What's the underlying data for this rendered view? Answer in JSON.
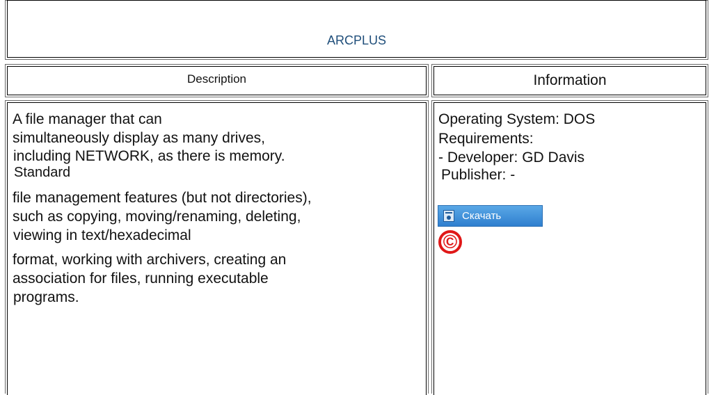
{
  "program": {
    "title": "ARCPLUS"
  },
  "headers": {
    "description": "Description",
    "information": "Information"
  },
  "description_lines": [
    "A file manager that can",
    "simultaneously display as many drives,",
    "including NETWORK, as there is memory.",
    "Standard",
    "file management features (but not directories),",
    "such as copying, moving/renaming, deleting,",
    "viewing in text/hexadecimal",
    "format, working with archivers, creating an",
    "association for files, running executable",
    "programs."
  ],
  "info": {
    "os": "Operating System: DOS",
    "requirements": "Requirements:",
    "developer": "- Developer: GD Davis",
    "publisher": "Publisher: -",
    "download_label": "Скачать",
    "copyright_symbol": "©"
  },
  "colors": {
    "title": "#1f4e7a",
    "download_button": "#3a8bd8",
    "copyright": "#e01818"
  },
  "icons": {
    "download": "download-icon",
    "copyright": "copyright-icon"
  }
}
